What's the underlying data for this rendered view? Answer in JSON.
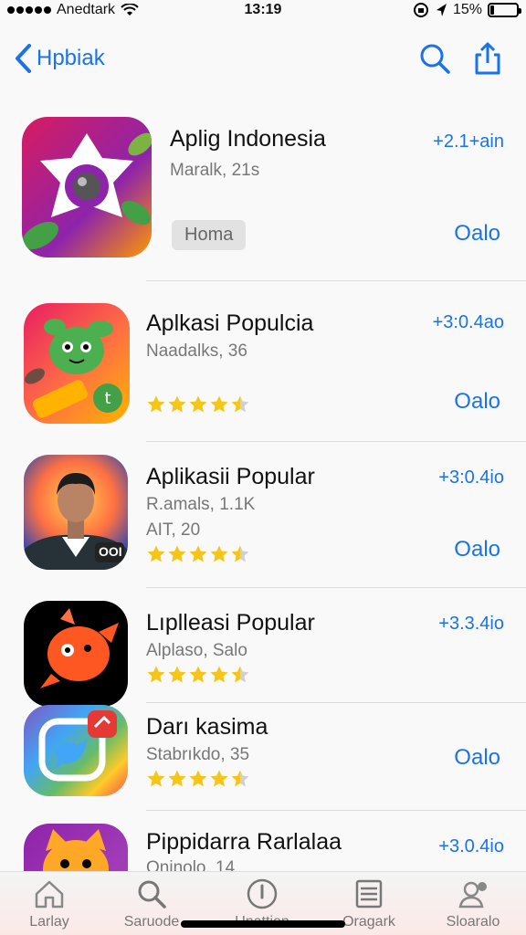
{
  "status_bar": {
    "carrier": "Anedtark",
    "time": "13:19",
    "battery_text": "15%",
    "battery_level": 0.15
  },
  "nav": {
    "back_label": "Hpbiak"
  },
  "colors": {
    "accent": "#1a73e8",
    "star": "#f5c518",
    "star_empty": "#d0d0d0"
  },
  "apps": [
    {
      "name": "Aplig Indonesia",
      "subtitle": "Maralk, 21s",
      "price": "+2.1+ain",
      "action": "Oalo",
      "badge": "Homa",
      "icon": "camera-app-icon"
    },
    {
      "name": "Aplkasi Populcia",
      "subtitle": "Naadalks, 36",
      "price": "+3:0.4ao",
      "action": "Oalo",
      "rating": 4.5,
      "icon": "green-creature-app-icon"
    },
    {
      "name": "Aplikasii Popular",
      "subtitle": "R.amals, 1.1K",
      "subtitle2": "AIT, 20",
      "price": "+3:0.4io",
      "action": "Oalo",
      "rating": 4.5,
      "icon": "portrait-app-icon",
      "icon_overlay": "OOI"
    },
    {
      "name": "Lıplleasi Popular",
      "subtitle": "Alplaso, Salo",
      "price": "+3.3.4io",
      "rating": 4.5,
      "icon": "orange-bird-app-icon"
    },
    {
      "name": "Darı kasima",
      "subtitle": "Stabrıkdo, 35",
      "action": "Oalo",
      "rating": 4.5,
      "icon": "bird-chat-app-icon"
    },
    {
      "name": "Pippidarra Rarlalaa",
      "subtitle": "Oninolo, 14",
      "price": "+3.0.4io",
      "icon": "cat-app-icon"
    }
  ],
  "tabs": [
    {
      "label": "Larlay",
      "icon": "home-icon"
    },
    {
      "label": "Saruode",
      "icon": "search-icon"
    },
    {
      "label": "Unattion",
      "icon": "alert-icon"
    },
    {
      "label": "Oragark",
      "icon": "list-icon"
    },
    {
      "label": "Sloaralo",
      "icon": "profile-icon"
    }
  ]
}
